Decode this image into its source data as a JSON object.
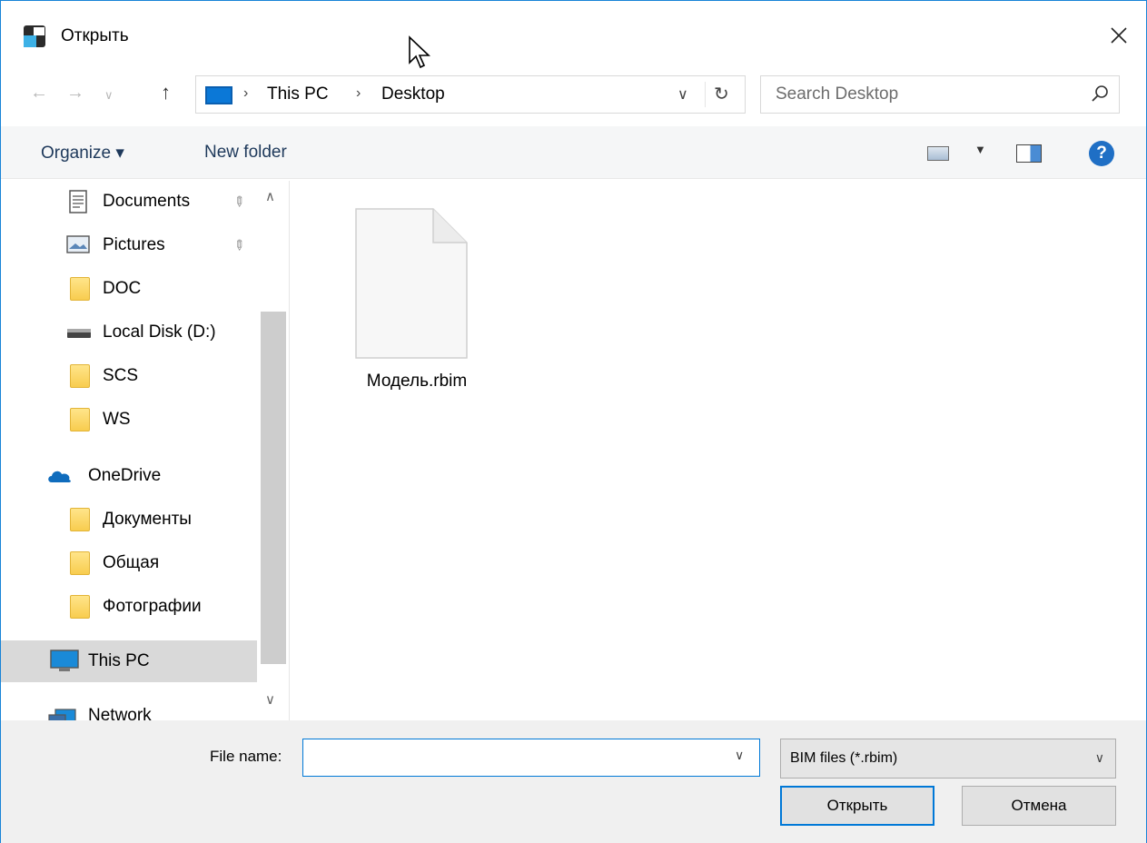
{
  "window": {
    "title": "Открыть"
  },
  "nav": {
    "breadcrumb": [
      "This PC",
      "Desktop"
    ],
    "search_placeholder": "Search Desktop"
  },
  "toolbar": {
    "organize_label": "Organize ▾",
    "new_folder_label": "New folder",
    "help_glyph": "?"
  },
  "sidebar": {
    "items": [
      {
        "label": "Documents",
        "icon": "documents-icon",
        "pinned": true
      },
      {
        "label": "Pictures",
        "icon": "pictures-icon",
        "pinned": true
      },
      {
        "label": "DOC",
        "icon": "folder-icon"
      },
      {
        "label": "Local Disk (D:)",
        "icon": "drive-icon"
      },
      {
        "label": "SCS",
        "icon": "folder-icon"
      },
      {
        "label": "WS",
        "icon": "folder-icon"
      },
      {
        "label": "OneDrive",
        "icon": "onedrive-icon"
      },
      {
        "label": "Документы",
        "icon": "folder-icon"
      },
      {
        "label": "Общая",
        "icon": "folder-icon"
      },
      {
        "label": "Фотографии",
        "icon": "folder-icon"
      },
      {
        "label": "This PC",
        "icon": "pc-icon",
        "selected": true
      },
      {
        "label": "Network",
        "icon": "network-icon"
      }
    ]
  },
  "files": [
    {
      "name": "Модель.rbim",
      "icon": "blank-file-icon"
    }
  ],
  "footer": {
    "filename_label": "File name:",
    "filename_value": "",
    "filetype_value": "BIM files (*.rbim)",
    "open_label": "Открыть",
    "cancel_label": "Отмена"
  },
  "colors": {
    "accent": "#0078d7",
    "selection": "#d9d9d9",
    "toolbar_bg": "#f5f6f7",
    "footer_bg": "#f0f0f0"
  }
}
